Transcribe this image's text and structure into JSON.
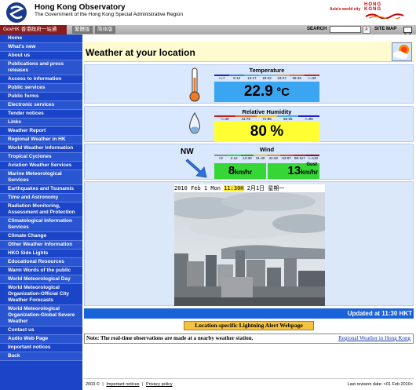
{
  "header": {
    "title": "Hong Kong Observatory",
    "subtitle": "The Government of the Hong Kong Special Administrative Region",
    "asia_tag": "Asia's world city",
    "brand_line1": "HONG",
    "brand_line2": "KONG"
  },
  "tabbar": {
    "govhk": "GovHK 香港政府一站通",
    "trad": "繁體版",
    "simp": "简体版",
    "search_label": "SEARCH",
    "search_value": "",
    "search_icon": "search-icon",
    "sitemap": "SITE MAP",
    "mail_icon": "mail-icon"
  },
  "sidebar": {
    "items": [
      {
        "label": "Home"
      },
      {
        "label": "What's new"
      },
      {
        "label": "About us"
      },
      {
        "label": "Publications and press releases"
      },
      {
        "label": "Access to information"
      },
      {
        "label": "Public services"
      },
      {
        "label": "Public forms"
      },
      {
        "label": "Electronic services"
      },
      {
        "label": "Tender notices"
      },
      {
        "label": "Links"
      },
      {
        "label": "Weather Report"
      },
      {
        "label": "Regional Weather in HK"
      },
      {
        "label": "World Weather Information"
      },
      {
        "label": "Tropical Cyclones"
      },
      {
        "label": "Aviation Weather Services"
      },
      {
        "label": "Marine Meteorological Services"
      },
      {
        "label": "Earthquakes and Tsunamis"
      },
      {
        "label": "Time and Astronomy"
      },
      {
        "label": "Radiation Monitoring, Assessment and Protection"
      },
      {
        "label": "Climatological Information Services"
      },
      {
        "label": "Climate Change"
      },
      {
        "label": "Other Weather Information"
      },
      {
        "label": "HKO Side Lights"
      },
      {
        "label": "Educational Resources"
      },
      {
        "label": "Warm Words of the public"
      },
      {
        "label": "World Meteorological Day"
      },
      {
        "label": "World Meteorological Organization-Official City Weather Forecasts"
      },
      {
        "label": "World Meteorological Organization-Global Severe Weather"
      },
      {
        "label": "Contact us"
      },
      {
        "label": "Audio Web Page"
      },
      {
        "label": "Important notices"
      },
      {
        "label": "Back"
      }
    ]
  },
  "main": {
    "page_title": "Weather at your location",
    "temperature": {
      "title": "Temperature",
      "scale": [
        "<=7",
        "8-12",
        "13-17",
        "18-22",
        "23-27",
        "28-32",
        ">=33"
      ],
      "scale_colors": [
        "#2222cc",
        "#3a7dd8",
        "#55a7e0",
        "#7ab8e8",
        "#e0a050",
        "#e07030",
        "#d02020"
      ],
      "value": "22.9",
      "unit": "°C",
      "box_color": "#3aa6f2"
    },
    "humidity": {
      "title": "Relative Humidity",
      "scale": [
        "<=40",
        "41-70",
        "71-85",
        "86-95",
        ">=96"
      ],
      "scale_colors": [
        "#d02020",
        "#e07030",
        "#e8c040",
        "#55a7e0",
        "#2222cc"
      ],
      "value": "80",
      "unit": "%",
      "box_color": "#ffff33"
    },
    "wind": {
      "title": "Wind",
      "direction": "NW",
      "scale": [
        "<2",
        "2-12",
        "13-30",
        "31-40",
        "41-62",
        "63-87",
        "88-117",
        ">=118"
      ],
      "scale_colors": [
        "#8a8a8a",
        "#35d635",
        "#2a9a2a",
        "#e8c040",
        "#e09030",
        "#d05020",
        "#c02020",
        "#901010"
      ],
      "speed": "8",
      "gust": "13",
      "unit": "km/hr",
      "gust_label": "Gust",
      "box_color": "#35d635"
    },
    "camera": {
      "timestamp_pre": "2010 Feb 1 Mon ",
      "timestamp_time": "11:30H",
      "timestamp_post": " 2月1日 星期一"
    },
    "updated": "Updated at 11:30 HKT",
    "lightning_button": "Location-specific Lightning Alert Webpage",
    "note": "Note: The real-time observations are made at a nearby weather station.",
    "regional_link": "Regional Weather in Hong Kong"
  },
  "footer": {
    "copyright": "2003 ©",
    "sep1": "|",
    "important_notices": "Important notices",
    "sep2": "|",
    "privacy_policy": "Privacy policy",
    "revision": "Last revision date: <01 Feb 2010>"
  }
}
